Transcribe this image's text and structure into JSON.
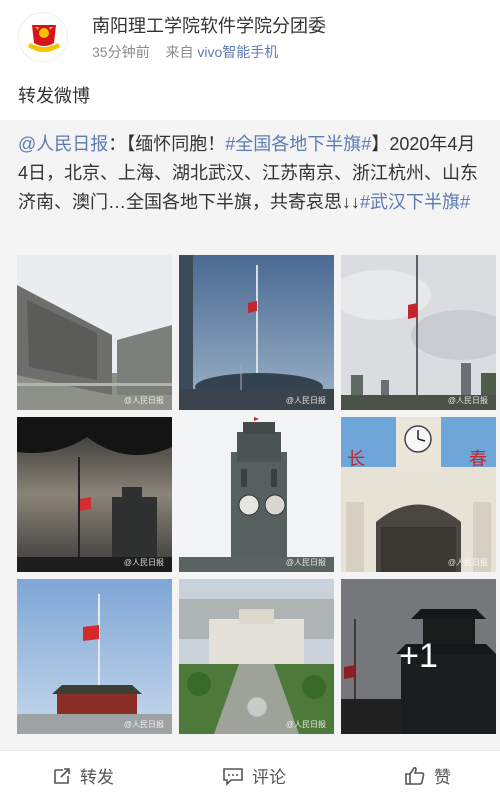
{
  "post": {
    "author_name": "南阳理工学院软件学院分团委",
    "time": "35分钟前",
    "source_prefix": "来自",
    "source_device": "vivo智能手机",
    "repost_text": "转发微博",
    "avatar_icon": "youth-league-emblem-icon"
  },
  "quoted": {
    "author_link": "@人民日报",
    "colon": "：",
    "bracket_open": "【",
    "headline": "缅怀同胞！",
    "tag_1": "#全国各地下半旗#",
    "bracket_close": "】",
    "body": "2020年4月4日，北京、上海、湖北武汉、江苏南京、浙江杭州、山东济南、澳门…全国各地下半旗，共寄哀思↓↓",
    "tag_2": "#武汉下半旗#",
    "images": [
      {
        "name": "memorial-relief-photo"
      },
      {
        "name": "flag-half-mast-arena-photo"
      },
      {
        "name": "flag-half-mast-city-photo"
      },
      {
        "name": "flag-tree-silhouette-photo"
      },
      {
        "name": "clock-tower-photo"
      },
      {
        "name": "changchun-station-photo"
      },
      {
        "name": "tiananmen-flag-photo"
      },
      {
        "name": "government-building-aerial-photo"
      },
      {
        "name": "pagoda-silhouette-photo"
      }
    ],
    "more_count": "+1"
  },
  "actions": {
    "repost_label": "转发",
    "comment_label": "评论",
    "like_label": "赞",
    "repost_icon": "repost-icon",
    "comment_icon": "comment-icon",
    "like_icon": "thumbs-up-icon"
  },
  "colors": {
    "link": "#5c7ab4",
    "meta": "#8c8c8c",
    "quoted_bg": "#f4f4f4",
    "emblem_red": "#d7141a",
    "emblem_gold": "#f5c400"
  }
}
